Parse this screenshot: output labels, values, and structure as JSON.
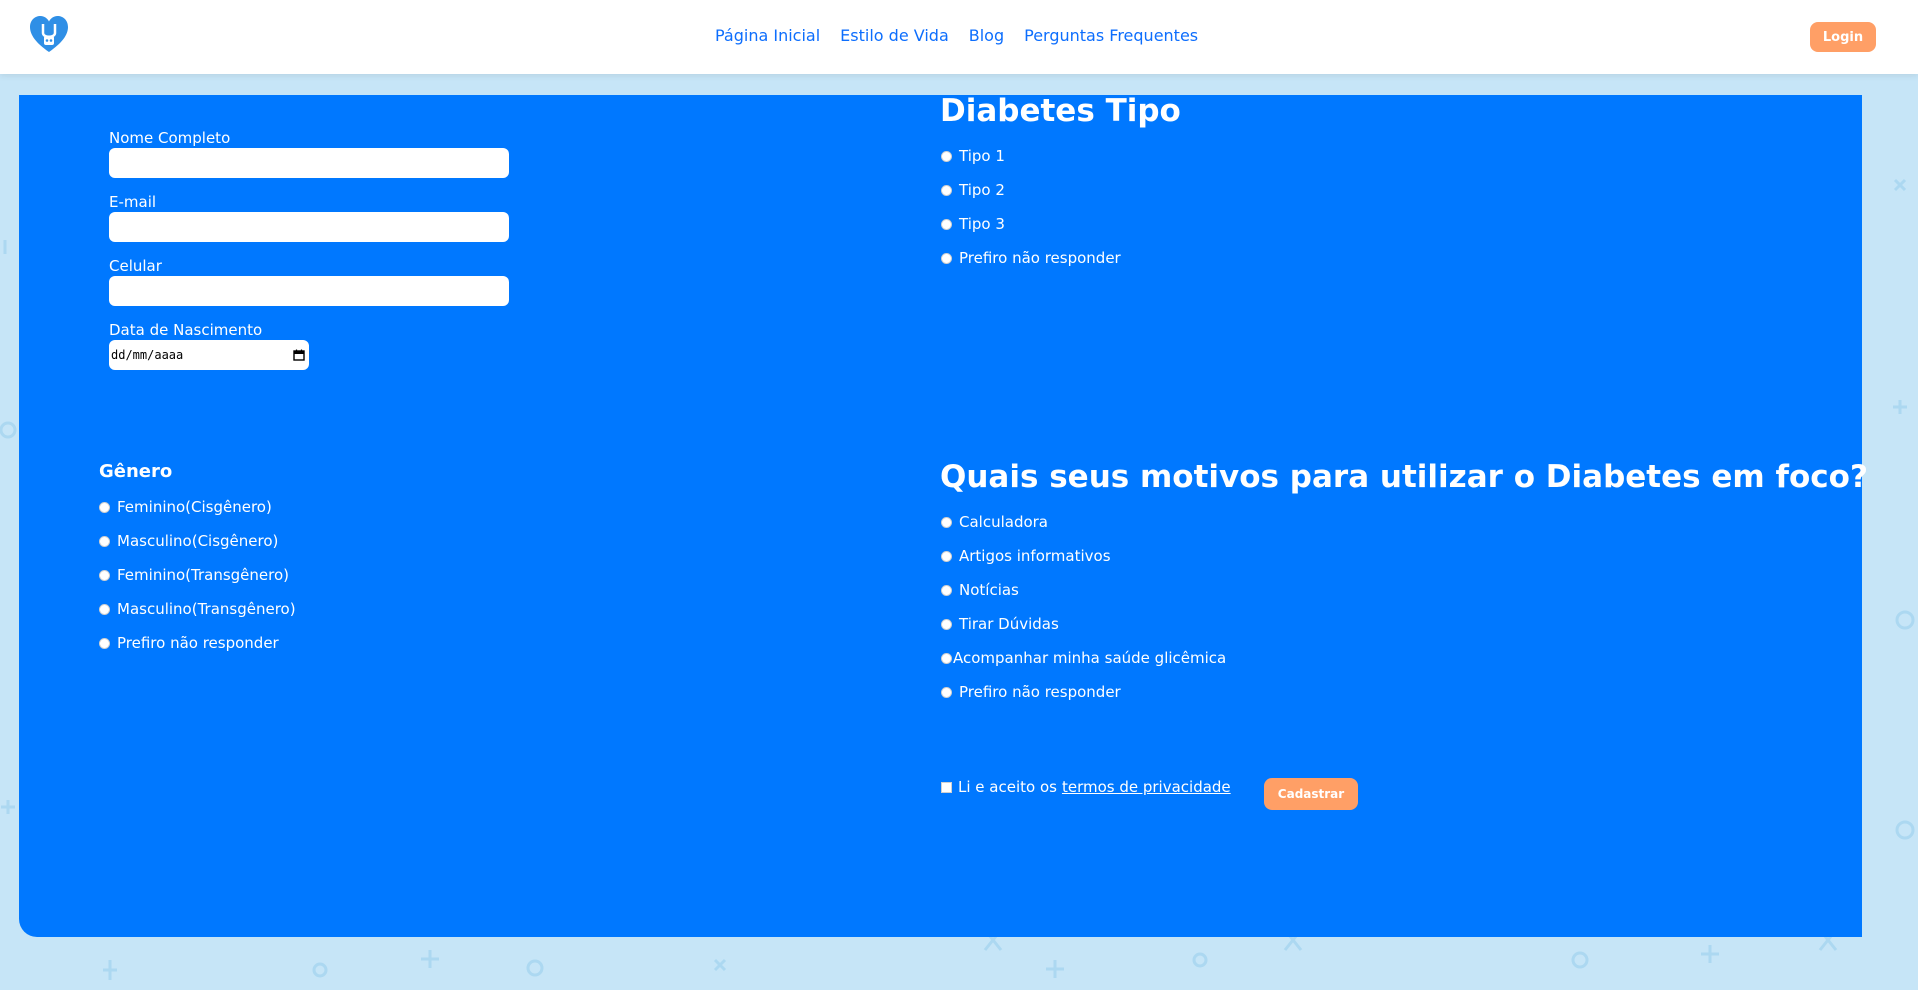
{
  "nav": {
    "links": [
      "Página Inicial",
      "Estilo de Vida",
      "Blog",
      "Perguntas Frequentes"
    ],
    "login_label": "Login"
  },
  "form": {
    "full_name_label": "Nome Completo",
    "email_label": "E-mail",
    "phone_label": "Celular",
    "birthdate_label": "Data de Nascimento",
    "birthdate_placeholder": "dd/mm/aaaa"
  },
  "diabetes_type": {
    "title": "Diabetes Tipo",
    "options": [
      "Tipo 1",
      "Tipo 2",
      "Tipo 3",
      "Prefiro não responder"
    ]
  },
  "gender": {
    "title": "Gênero",
    "options": [
      "Feminino(Cisgênero)",
      "Masculino(Cisgênero)",
      "Feminino(Transgênero)",
      "Masculino(Transgênero)",
      "Prefiro não responder"
    ]
  },
  "motives": {
    "title": "Quais seus motivos para utilizar o Diabetes em foco?",
    "options": [
      "Calculadora",
      "Artigos informativos",
      "Notícias",
      "Tirar Dúvidas",
      "Acompanhar minha saúde glicêmica",
      "Prefiro não responder"
    ]
  },
  "terms": {
    "text": "Li e aceito os",
    "link": "termos de privacidade"
  },
  "submit_label": "Cadastrar",
  "colors": {
    "panel": "#0078ff",
    "accent": "#ff9f66",
    "nav_text": "#0d6efd",
    "background": "#c6e5f7"
  },
  "icons": {
    "logo": "heart-stethoscope-icon",
    "date_picker": "calendar-icon"
  }
}
